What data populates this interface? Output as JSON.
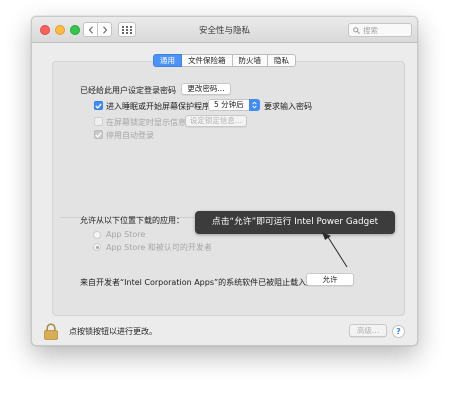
{
  "window": {
    "title": "安全性与隐私",
    "search_placeholder": "搜索"
  },
  "tabs": [
    {
      "label": "通用",
      "active": true
    },
    {
      "label": "文件保险箱",
      "active": false
    },
    {
      "label": "防火墙",
      "active": false
    },
    {
      "label": "隐私",
      "active": false
    }
  ],
  "general": {
    "login_password_text": "已经给此用户设定登录密码",
    "change_password_button": "更改密码...",
    "require_password": {
      "checked": true,
      "label_prefix": "进入睡眠或开始屏幕保护程序",
      "delay_value": "5 分钟后",
      "label_suffix": "要求输入密码"
    },
    "show_message": {
      "checked": false,
      "label": "在屏幕锁定时显示信息",
      "button": "设定锁定信息..."
    },
    "disable_auto_login": {
      "checked": true,
      "label": "停用自动登录"
    }
  },
  "downloads": {
    "label": "允许从以下位置下载的应用：",
    "options": [
      {
        "label": "App Store",
        "selected": false
      },
      {
        "label": "App Store 和被认可的开发者",
        "selected": true
      }
    ],
    "blocked_message": "来自开发者“Intel Corporation Apps”的系统软件已被阻止载入。",
    "allow_button": "允许"
  },
  "annotation": {
    "text": "点击“允许”即可运行 Intel Power Gadget"
  },
  "footer": {
    "lock_text": "点按锁按钮以进行更改。",
    "advanced_button": "高级...",
    "help_label": "?"
  },
  "colors": {
    "accent": "#3f8df5",
    "tab_active": "#4c93f7",
    "tooltip_bg": "#3c3c3c"
  }
}
